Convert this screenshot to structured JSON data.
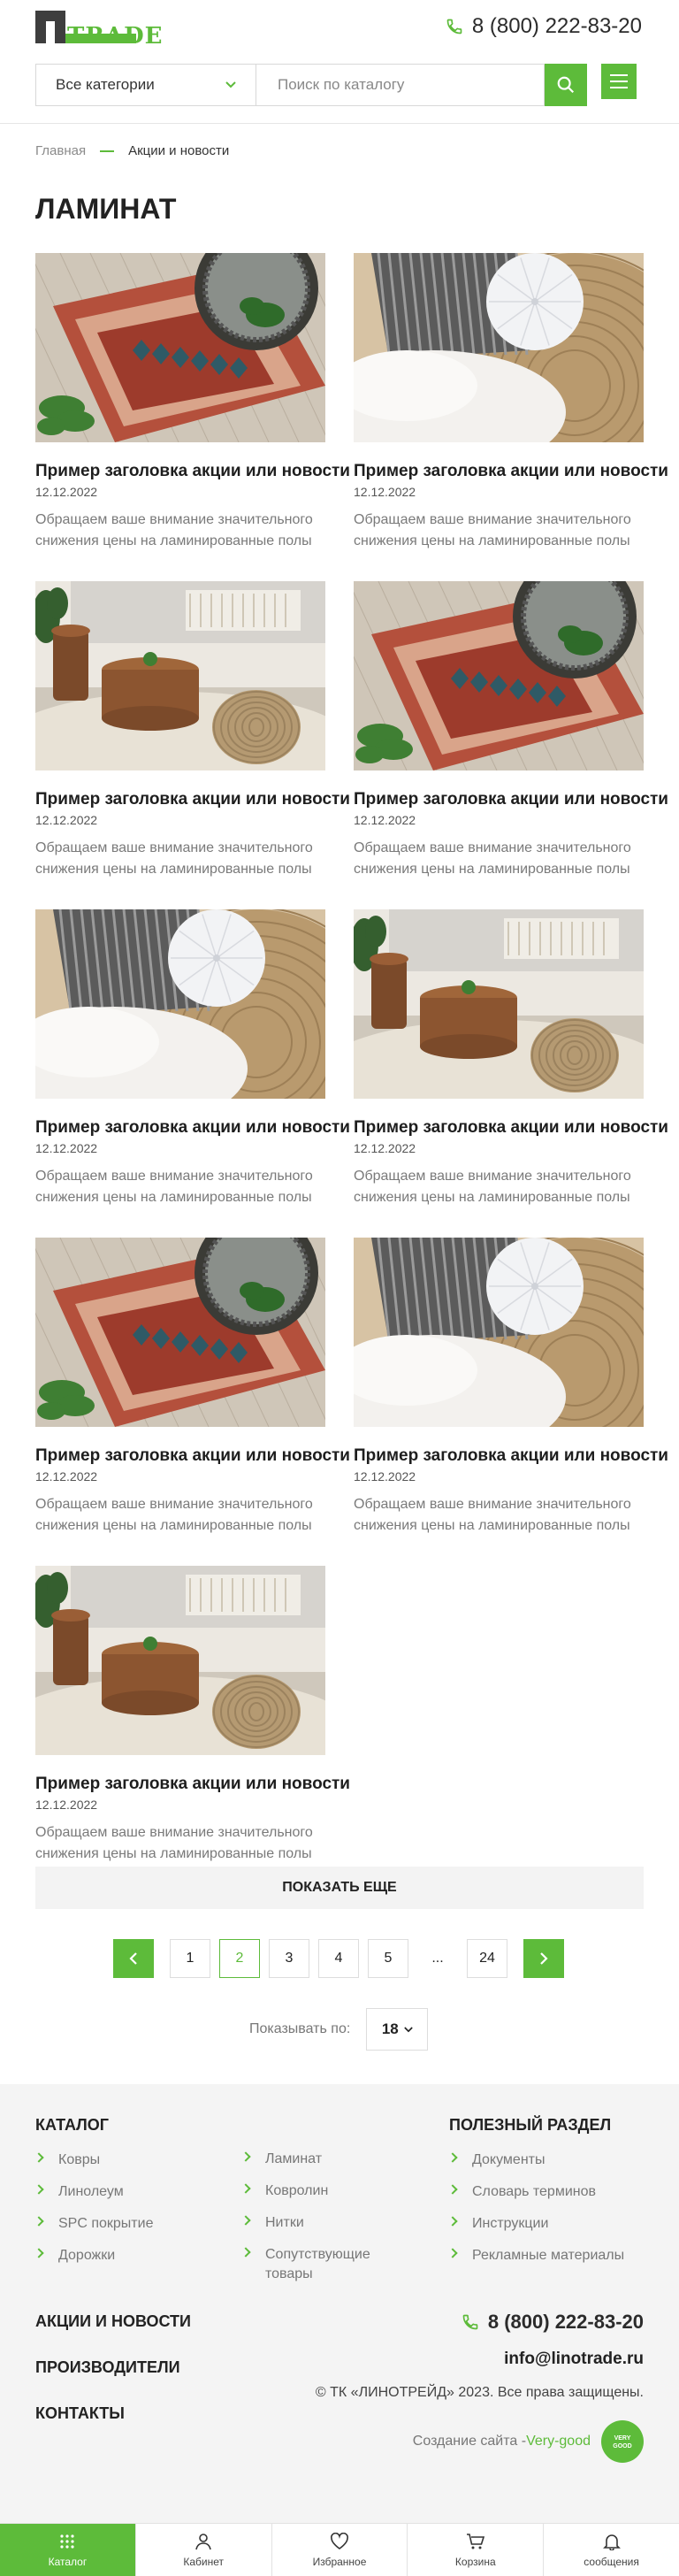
{
  "header": {
    "logo_text": "TRADE",
    "phone": "8 (800) 222-83-20",
    "category_select": "Все категории",
    "search_placeholder": "Поиск по каталогу"
  },
  "breadcrumbs": [
    "Главная",
    "Акции и новости"
  ],
  "page_title": "ЛАМИНАТ",
  "cards": [
    {
      "title": "Пример заголовка акции или новости",
      "date": "12.12.2022",
      "desc": "Обращаем ваше внимание значительного снижения цены на ламинированные полы",
      "image": "rug-mirror"
    },
    {
      "title": "Пример заголовка акции или новости",
      "date": "12.12.2022",
      "desc": "Обращаем ваше внимание значительного снижения цены на ламинированные полы",
      "image": "pillows-fur"
    },
    {
      "title": "Пример заголовка акции или новости",
      "date": "12.12.2022",
      "desc": "Обращаем ваше внимание значительного снижения цены на ламинированные полы",
      "image": "living-room"
    },
    {
      "title": "Пример заголовка акции или новости",
      "date": "12.12.2022",
      "desc": "Обращаем ваше внимание значительного снижения цены на ламинированные полы",
      "image": "rug-mirror"
    },
    {
      "title": "Пример заголовка акции или новости",
      "date": "12.12.2022",
      "desc": "Обращаем ваше внимание значительного снижения цены на ламинированные полы",
      "image": "pillows-fur"
    },
    {
      "title": "Пример заголовка акции или новости",
      "date": "12.12.2022",
      "desc": "Обращаем ваше внимание значительного снижения цены на ламинированные полы",
      "image": "living-room"
    },
    {
      "title": "Пример заголовка акции или новости",
      "date": "12.12.2022",
      "desc": "Обращаем ваше внимание значительного снижения цены на ламинированные полы",
      "image": "rug-mirror"
    },
    {
      "title": "Пример заголовка акции или новости",
      "date": "12.12.2022",
      "desc": "Обращаем ваше внимание значительного снижения цены на ламинированные полы",
      "image": "pillows-fur"
    },
    {
      "title": "Пример заголовка акции или новости",
      "date": "12.12.2022",
      "desc": "Обращаем ваше внимание значительного снижения цены на ламинированные полы",
      "image": "living-room"
    }
  ],
  "show_more": "ПОКАЗАТЬ ЕЩЕ",
  "pagination": {
    "pages": [
      "1",
      "2",
      "3",
      "4",
      "5",
      "...",
      "24"
    ],
    "current": "2"
  },
  "per_page": {
    "label": "Показывать по:",
    "value": "18"
  },
  "footer": {
    "catalog_title": "КАТАЛОГ",
    "catalog_col1": [
      "Ковры",
      "Линолеум",
      "SPC покрытие",
      "Дорожки"
    ],
    "catalog_col2": [
      "Ламинат",
      "Ковролин",
      "Нитки",
      "Сопутствующие товары"
    ],
    "useful_title": "ПОЛЕЗНЫЙ РАЗДЕЛ",
    "useful_items": [
      "Документы",
      "Словарь терминов",
      "Инструкции",
      "Рекламные материалы"
    ],
    "links": [
      "АКЦИИ И НОВОСТИ",
      "ПРОИЗВОДИТЕЛИ",
      "КОНТАКТЫ"
    ],
    "phone": "8 (800) 222-83-20",
    "email": "info@linotrade.ru",
    "copyright": "© ТК «ЛИНОТРЕЙД» 2023. Все права защищены.",
    "dev_label": "Создание сайта -",
    "dev_name": "Very-good",
    "dev_badge": "VERY GOOD"
  },
  "tabbar": [
    {
      "label": "Каталог",
      "icon": "grid-icon"
    },
    {
      "label": "Кабинет",
      "icon": "user-icon"
    },
    {
      "label": "Избранное",
      "icon": "heart-icon"
    },
    {
      "label": "Корзина",
      "icon": "cart-icon"
    },
    {
      "label": "сообщения",
      "icon": "bell-icon"
    }
  ],
  "colors": {
    "accent": "#5dbb3a",
    "text": "#222222",
    "muted": "#7a7a7a",
    "footer_bg": "#f4f4f4"
  }
}
